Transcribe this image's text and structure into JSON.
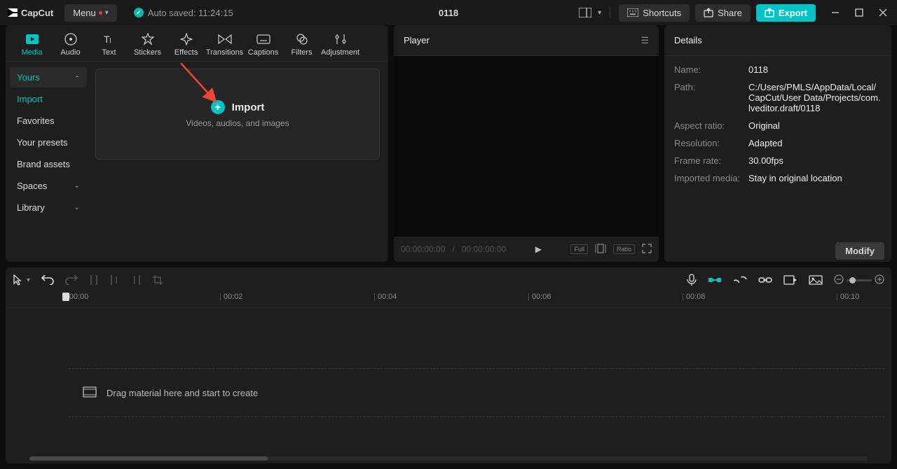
{
  "app": {
    "name": "CapCut"
  },
  "menu_label": "Menu",
  "autosave": "Auto saved: 11:24:15",
  "project_title": "0118",
  "toolbar": {
    "shortcuts": "Shortcuts",
    "share": "Share",
    "export": "Export"
  },
  "tabs": [
    {
      "label": "Media"
    },
    {
      "label": "Audio"
    },
    {
      "label": "Text"
    },
    {
      "label": "Stickers"
    },
    {
      "label": "Effects"
    },
    {
      "label": "Transitions"
    },
    {
      "label": "Captions"
    },
    {
      "label": "Filters"
    },
    {
      "label": "Adjustment"
    }
  ],
  "sidebar": {
    "items": [
      {
        "label": "Yours",
        "expandable": true,
        "selected": true
      },
      {
        "label": "Import"
      },
      {
        "label": "Favorites"
      },
      {
        "label": "Your presets"
      },
      {
        "label": "Brand assets"
      },
      {
        "label": "Spaces",
        "expandable": true
      },
      {
        "label": "Library",
        "expandable": true
      }
    ]
  },
  "import": {
    "title": "Import",
    "subtitle": "Videos, audios, and images"
  },
  "player": {
    "title": "Player",
    "time_cur": "00:00:00:00",
    "time_total": "00:00:00:00",
    "full": "Full",
    "ratio": "Ratio"
  },
  "details": {
    "title": "Details",
    "rows": {
      "name_label": "Name:",
      "name": "0118",
      "path_label": "Path:",
      "path": "C:/Users/PMLS/AppData/Local/CapCut/User Data/Projects/com.lveditor.draft/0118",
      "aspect_label": "Aspect ratio:",
      "aspect": "Original",
      "resolution_label": "Resolution:",
      "resolution": "Adapted",
      "framerate_label": "Frame rate:",
      "framerate": "30.00fps",
      "imported_label": "Imported media:",
      "imported": "Stay in original location"
    },
    "modify": "Modify"
  },
  "timeline": {
    "ruler": [
      "00:00",
      "00:02",
      "00:04",
      "00:06",
      "00:08",
      "00:10"
    ],
    "hint": "Drag material here and start to create"
  }
}
